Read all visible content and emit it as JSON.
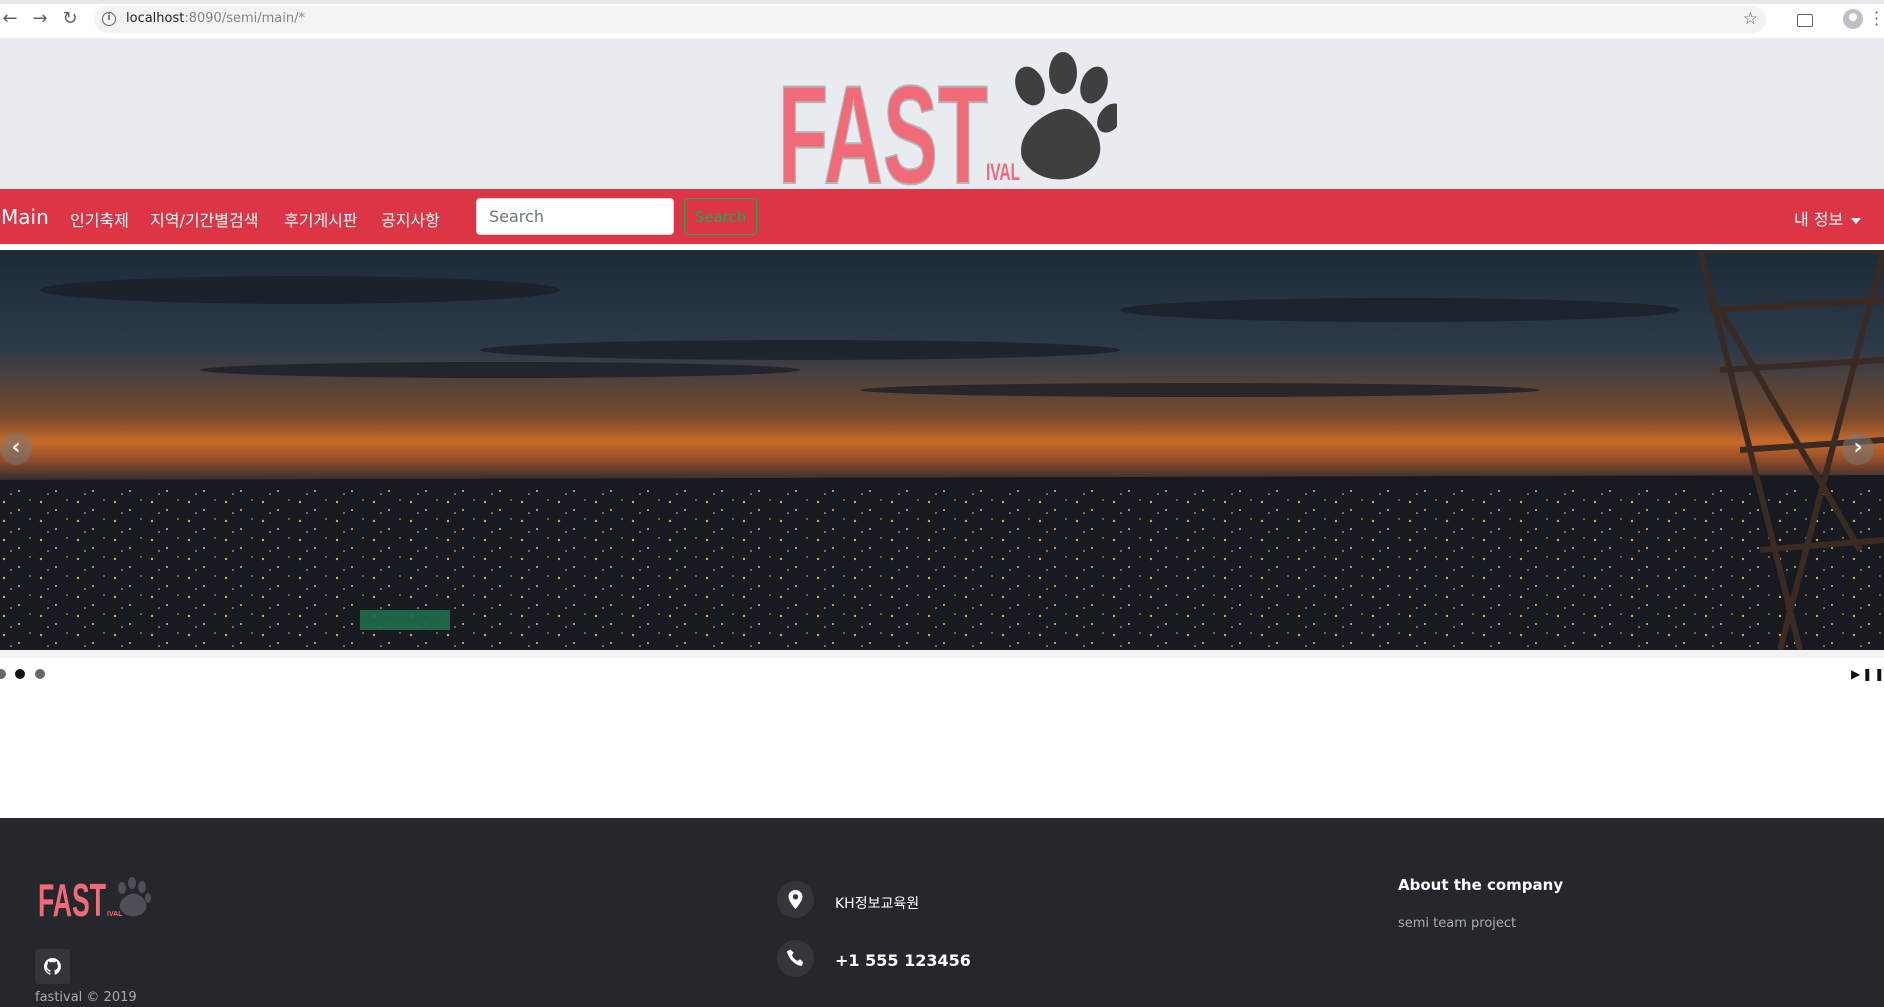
{
  "browser": {
    "url_host": "localhost",
    "url_rest": ":8090/semi/main/*"
  },
  "logo": {
    "wordmark": "FAST",
    "wordmark_suffix": "IVAL",
    "paw": "paw-icon"
  },
  "navbar": {
    "brand": "Main",
    "links": [
      "인기축제",
      "지역/기간별검색",
      "후기게시판",
      "공지사항"
    ],
    "search_placeholder": "Search",
    "search_button": "Search",
    "profile_menu": "내 정보",
    "color": "#dc3545"
  },
  "carousel": {
    "slides_count": 3,
    "active_slide": 2,
    "prev_icon": "chevron-left-icon",
    "next_icon": "chevron-right-icon",
    "play_icon": "play-icon",
    "pause_icon": "pause-icon"
  },
  "footer": {
    "logo_text": "FAST",
    "logo_suffix": "IVAL",
    "github_icon": "github-icon",
    "copyright": "fastival © 2019",
    "address_icon": "map-marker-icon",
    "address": "KH정보교육원",
    "phone_icon": "phone-icon",
    "phone": "+1 555 123456",
    "about_title": "About the company",
    "about_text": "semi team project",
    "bg_color": "#24272b"
  }
}
